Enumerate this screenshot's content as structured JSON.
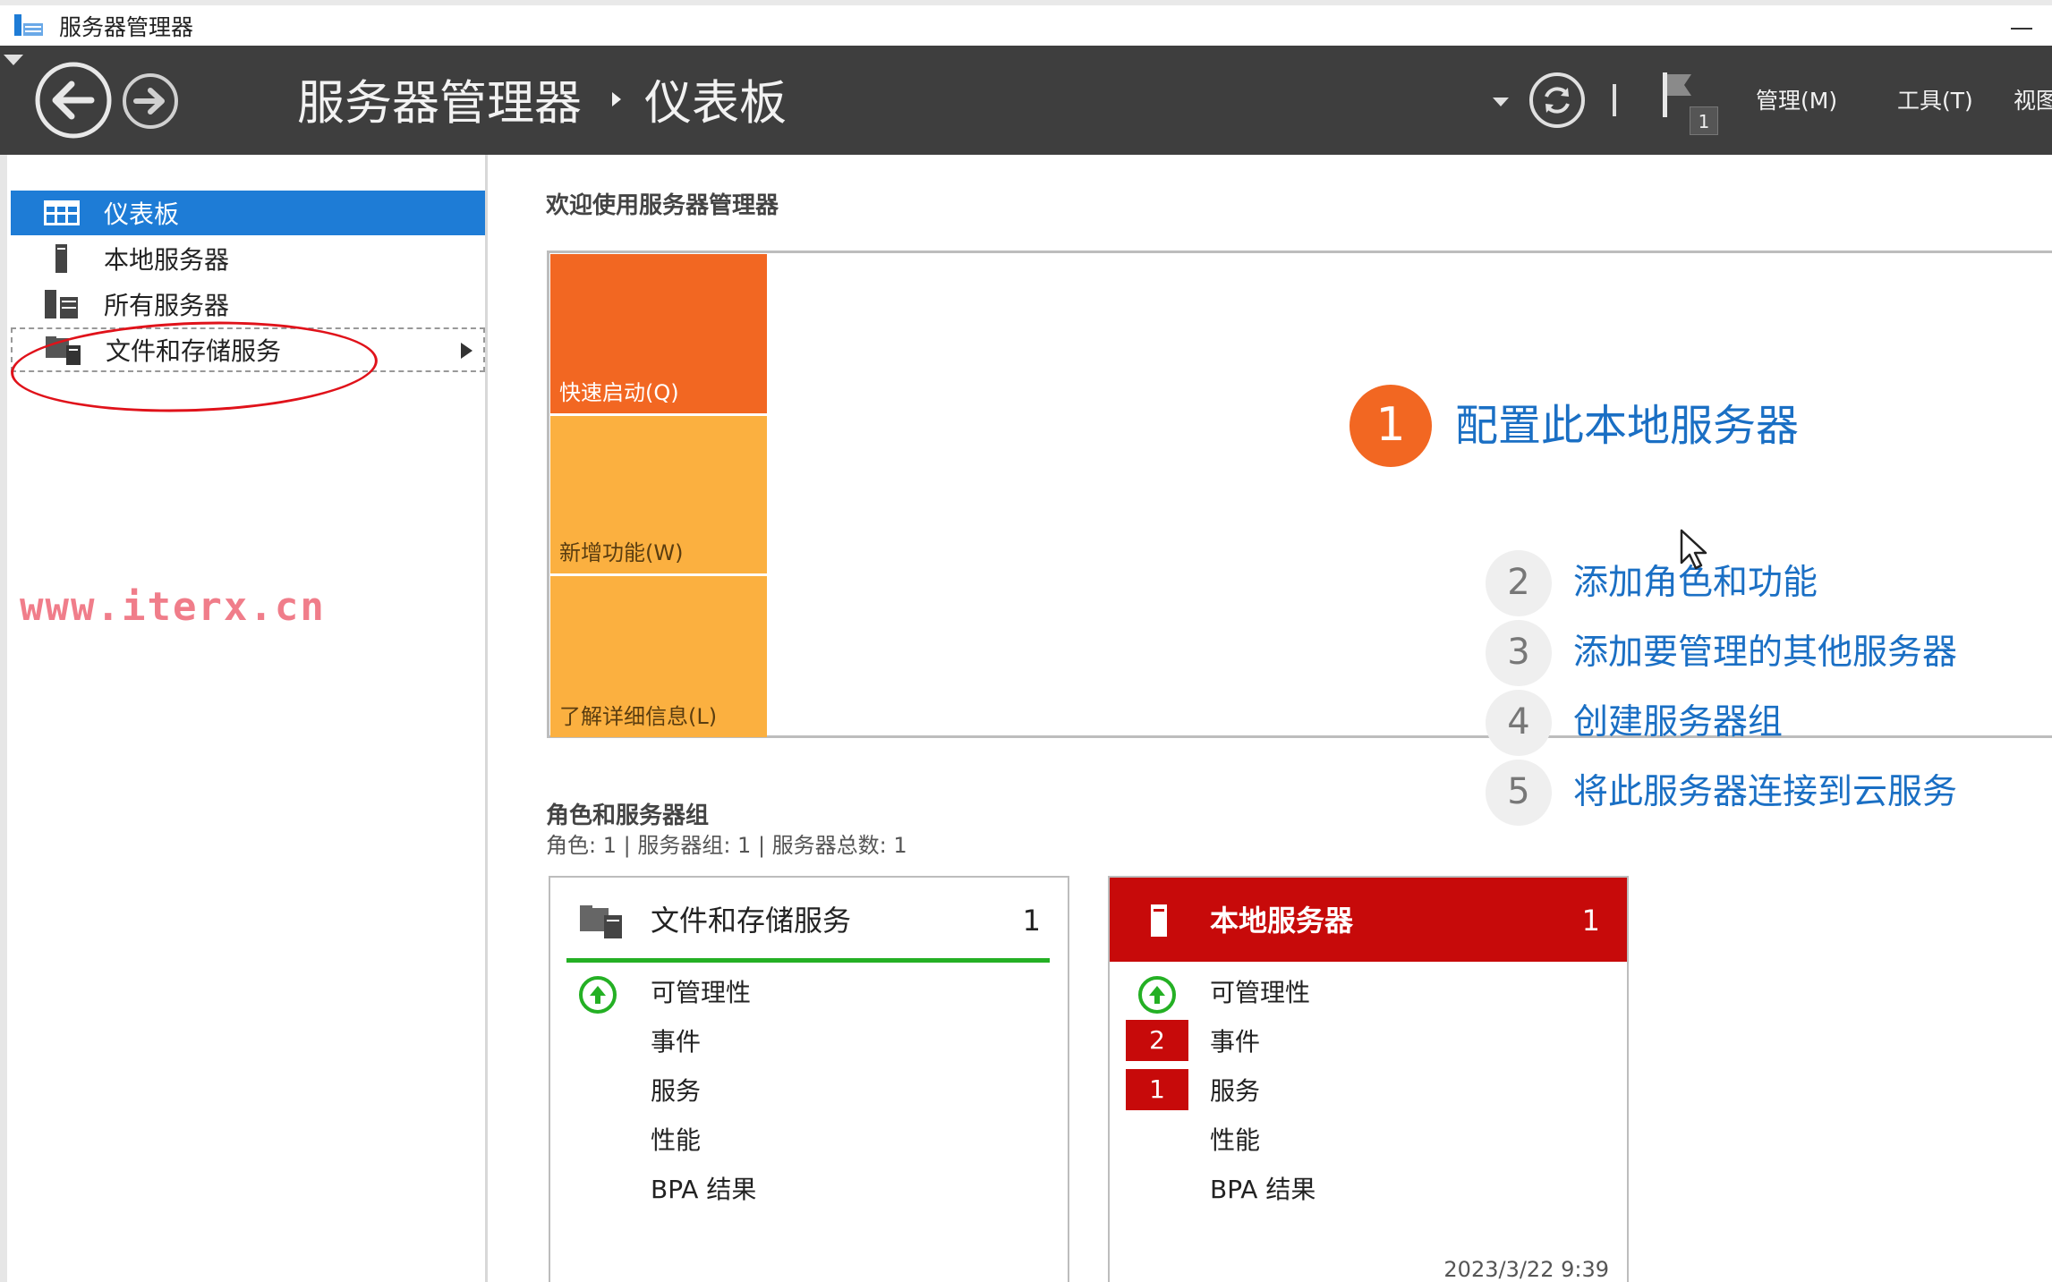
{
  "window": {
    "title": "服务器管理器"
  },
  "header": {
    "breadcrumb_root": "服务器管理器",
    "breadcrumb_current": "仪表板",
    "notification_count": "1",
    "menus": {
      "manage": "管理(M)",
      "tools": "工具(T)",
      "view": "视图"
    }
  },
  "sidebar": {
    "items": [
      {
        "label": "仪表板",
        "icon": "dashboard-icon",
        "selected": true
      },
      {
        "label": "本地服务器",
        "icon": "server-icon"
      },
      {
        "label": "所有服务器",
        "icon": "servers-icon"
      },
      {
        "label": "文件和存储服务",
        "icon": "file-storage-icon"
      }
    ]
  },
  "watermark": "www.iterx.cn",
  "welcome": {
    "heading": "欢迎使用服务器管理器",
    "tiles": {
      "quickstart": "快速启动(Q)",
      "whatsnew": "新增功能(W)",
      "learnmore": "了解详细信息(L)"
    },
    "steps": [
      {
        "num": "1",
        "label": "配置此本地服务器"
      },
      {
        "num": "2",
        "label": "添加角色和功能"
      },
      {
        "num": "3",
        "label": "添加要管理的其他服务器"
      },
      {
        "num": "4",
        "label": "创建服务器组"
      },
      {
        "num": "5",
        "label": "将此服务器连接到云服务"
      }
    ]
  },
  "roles": {
    "heading": "角色和服务器组",
    "summary": "角色: 1 | 服务器组: 1 | 服务器总数: 1",
    "cards": [
      {
        "title": "文件和存储服务",
        "count": "1",
        "rows": [
          "可管理性",
          "事件",
          "服务",
          "性能",
          "BPA 结果"
        ]
      },
      {
        "title": "本地服务器",
        "count": "1",
        "rows": [
          "可管理性",
          "事件",
          "服务",
          "性能",
          "BPA 结果"
        ],
        "badges": {
          "events": "2",
          "services": "1"
        },
        "timestamp": "2023/3/22 9:39"
      }
    ]
  },
  "colors": {
    "header": "#3e3e3e",
    "accent_blue": "#1e7cd6",
    "quickstart_orange": "#f26722",
    "tile_yellow": "#fbb040",
    "alert_red": "#c70a0a",
    "ok_green": "#24b024"
  }
}
